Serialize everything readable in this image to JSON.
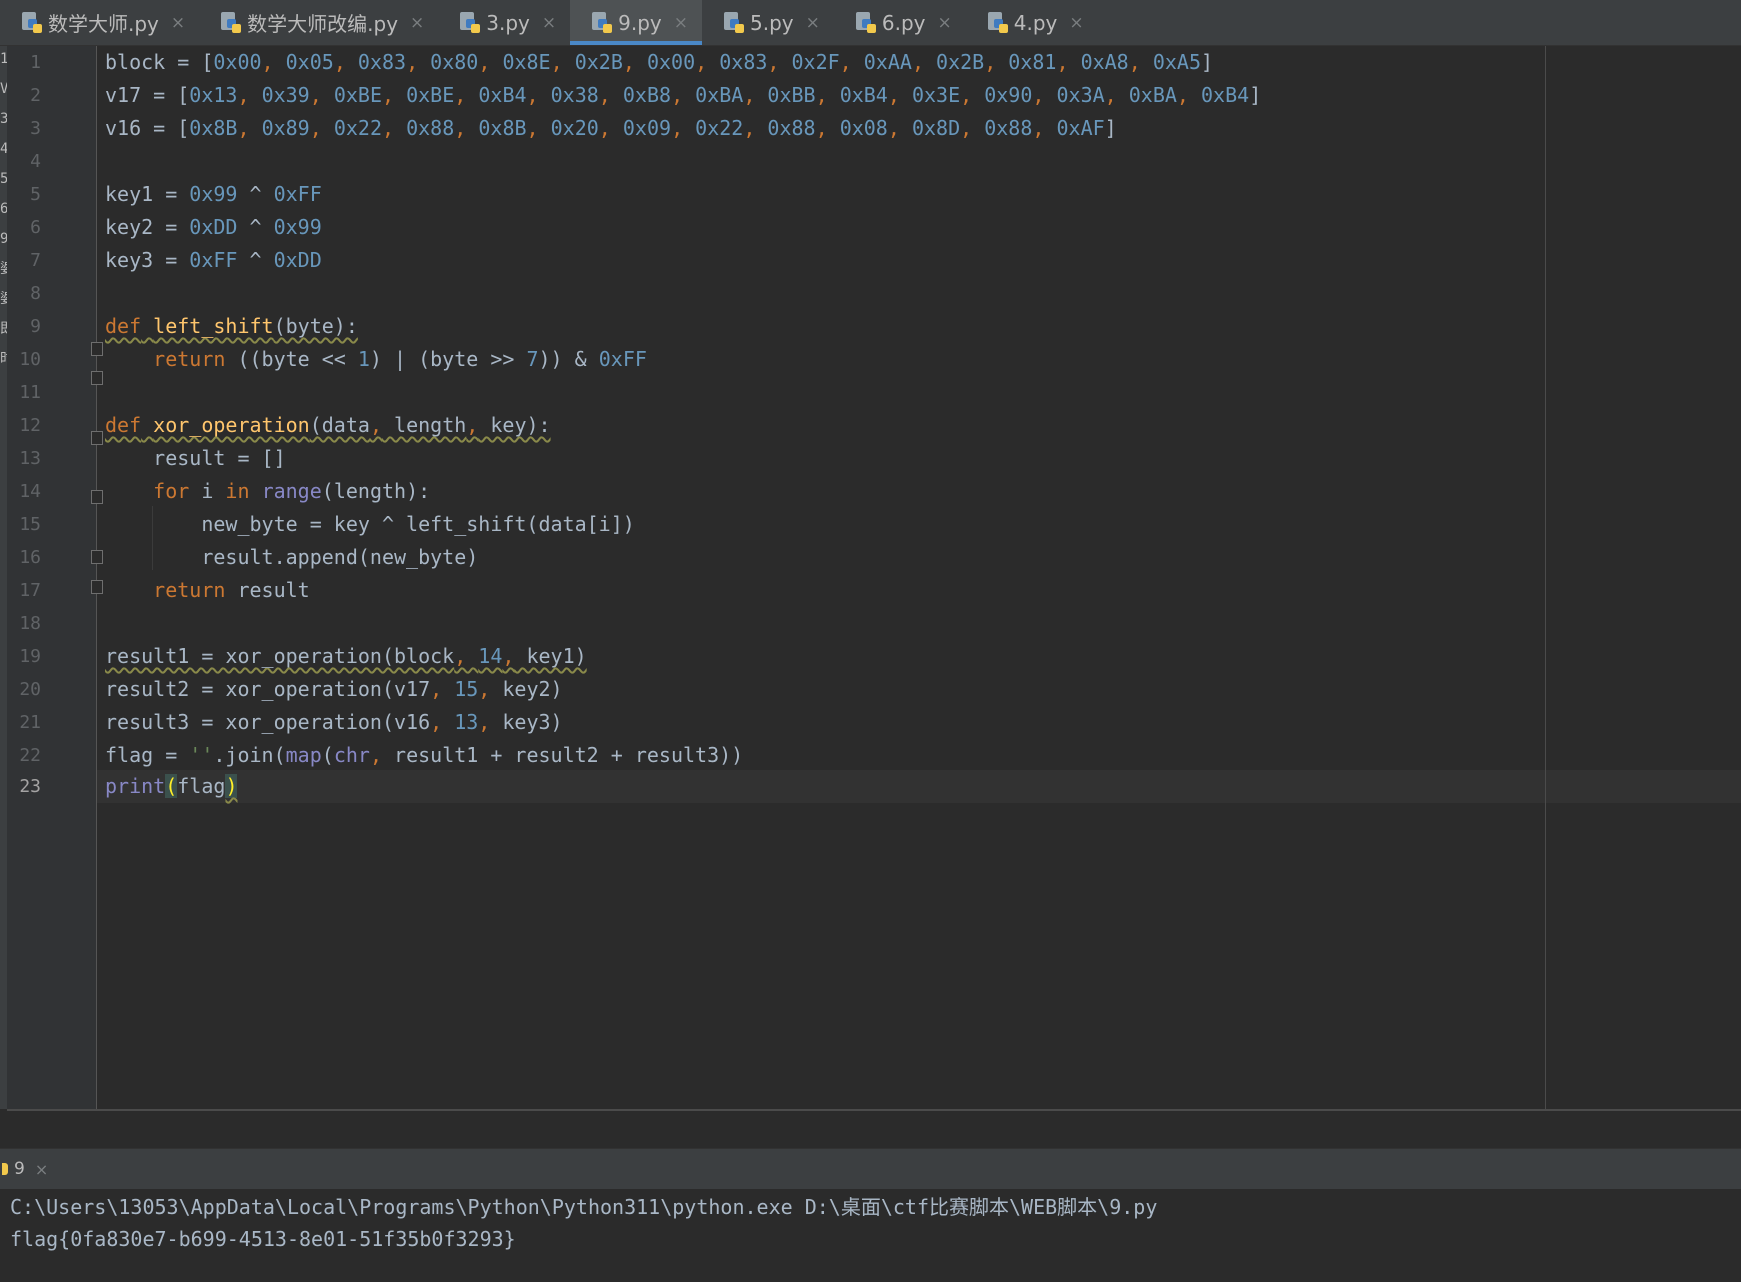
{
  "tabs": [
    {
      "label": "数学大师.py",
      "active": false
    },
    {
      "label": "数学大师改编.py",
      "active": false
    },
    {
      "label": "3.py",
      "active": false
    },
    {
      "label": "9.py",
      "active": true
    },
    {
      "label": "5.py",
      "active": false
    },
    {
      "label": "6.py",
      "active": false
    },
    {
      "label": "4.py",
      "active": false
    }
  ],
  "icons": {
    "tab": "python-file-icon",
    "close": "close-icon"
  },
  "close_glyph": "×",
  "line_numbers": [
    "1",
    "2",
    "3",
    "4",
    "5",
    "6",
    "7",
    "8",
    "9",
    "10",
    "11",
    "12",
    "13",
    "14",
    "15",
    "16",
    "17",
    "18",
    "19",
    "20",
    "21",
    "22",
    "23"
  ],
  "current_line": 23,
  "code": {
    "l1": {
      "a": "block = [",
      "n1": "0x00",
      "n2": "0x05",
      "n3": "0x83",
      "n4": "0x80",
      "n5": "0x8E",
      "n6": "0x2B",
      "n7": "0x00",
      "n8": "0x83",
      "n9": "0x2F",
      "n10": "0xAA",
      "n11": "0x2B",
      "n12": "0x81",
      "n13": "0xA8",
      "n14": "0xA5",
      "z": "]"
    },
    "l2": {
      "a": "v17 = [",
      "n1": "0x13",
      "n2": "0x39",
      "n3": "0xBE",
      "n4": "0xBE",
      "n5": "0xB4",
      "n6": "0x38",
      "n7": "0xB8",
      "n8": "0xBA",
      "n9": "0xBB",
      "n10": "0xB4",
      "n11": "0x3E",
      "n12": "0x90",
      "n13": "0x3A",
      "n14": "0xBA",
      "n15": "0xB4",
      "z": "]"
    },
    "l3": {
      "a": "v16 = [",
      "n1": "0x8B",
      "n2": "0x89",
      "n3": "0x22",
      "n4": "0x88",
      "n5": "0x8B",
      "n6": "0x20",
      "n7": "0x09",
      "n8": "0x22",
      "n9": "0x88",
      "n10": "0x08",
      "n11": "0x8D",
      "n12": "0x88",
      "n13": "0xAF",
      "z": "]"
    },
    "l5": {
      "a": "key1 = ",
      "n1": "0x99",
      "op": " ^ ",
      "n2": "0xFF"
    },
    "l6": {
      "a": "key2 = ",
      "n1": "0xDD",
      "op": " ^ ",
      "n2": "0x99"
    },
    "l7": {
      "a": "key3 = ",
      "n1": "0xFF",
      "op": " ^ ",
      "n2": "0xDD"
    },
    "l9": {
      "kw": "def",
      "fn": "left_shift",
      "rest": "(byte):"
    },
    "l10": {
      "kw": "return",
      "a": " ((byte << ",
      "n1": "1",
      "b": ") | (byte >> ",
      "n2": "7",
      "c": ")) & ",
      "n3": "0xFF"
    },
    "l12": {
      "kw": "def",
      "fn": "xor_operation",
      "a": "(data",
      "b": " length",
      "c": " key):"
    },
    "l13": {
      "a": "result = []"
    },
    "l14": {
      "kw": "for",
      "a": " i ",
      "kw2": "in",
      "b": " ",
      "bi": "range",
      "c": "(length):"
    },
    "l15": {
      "a": "new_byte = key ^ left_shift(data[i])"
    },
    "l16": {
      "a": "result.append(new_byte)"
    },
    "l17": {
      "kw": "return",
      "a": " result"
    },
    "l19": {
      "a": "result1 = xor_operation(block",
      "n": "14",
      "b": " key1)"
    },
    "l20": {
      "a": "result2 = xor_operation(v17",
      "n": "15",
      "b": " key2)"
    },
    "l21": {
      "a": "result3 = xor_operation(v16",
      "n": "13",
      "b": " key3)"
    },
    "l22": {
      "a": "flag = ",
      "s": "''",
      "b": ".join(",
      "bi1": "map",
      "c": "(",
      "bi2": "chr",
      "d": " result1 + result2 + result3))"
    },
    "l23": {
      "bi": "print",
      "p1": "(",
      "a": "flag",
      "p2": ")"
    }
  },
  "run": {
    "tab_label": "9",
    "command": "C:\\Users\\13053\\AppData\\Local\\Programs\\Python\\Python311\\python.exe D:\\桌面\\ctf比赛脚本\\WEB脚本\\9.py",
    "output": "flag{0fa830e7-b699-4513-8e01-51f35b0f3293}"
  },
  "left_strip_chars": [
    "1",
    "V",
    "3",
    "4",
    "5",
    "6",
    "9",
    "婆",
    "婆",
    "即",
    "时"
  ],
  "colors": {
    "keyword": "#cc7832",
    "number": "#6897bb",
    "function": "#ffc66d",
    "builtin": "#8888c6",
    "string": "#6a8759",
    "accent": "#4a88c7"
  }
}
